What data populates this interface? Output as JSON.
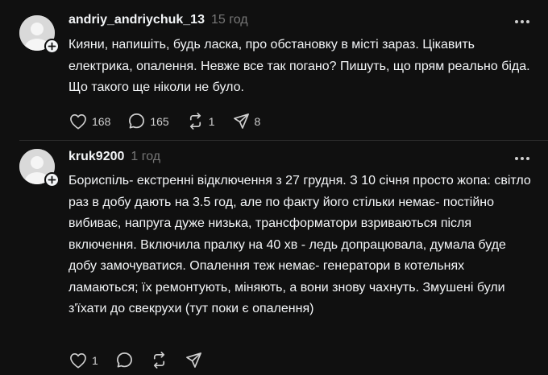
{
  "posts": [
    {
      "username": "andriy_andriychuk_13",
      "timestamp": "15 год",
      "text": "Кияни, напишіть, будь ласка, про обстановку в місті зараз. Цікавить електрика, опалення. Невже все так погано? Пишуть, що прям реально біда. Що такого ще ніколи не було.",
      "likes": "168",
      "replies": "165",
      "reposts": "1",
      "shares": "8"
    },
    {
      "username": "kruk9200",
      "timestamp": "1 год",
      "text": "Бориспіль- екстренні відключення з 27 грудня. З 10 січня просто жопа: світло раз в добу дають на 3.5 год, але по факту його стільки немає- постійно вибиває, напруга дуже низька, трансформатори взриваються після включення. Включила пралку на 40 хв - ледь допрацювала, думала буде добу замочуватися. Опалення теж немає- генератори в котельнях ламаються; їх ремонтують, міняють, а вони знову чахнуть. Змушені були з'їхати до свекрухи (тут поки є опалення)",
      "likes": "1",
      "replies": "",
      "reposts": "",
      "shares": ""
    }
  ],
  "icons": {
    "avatar": "default-avatar-icon",
    "follow": "plus-icon",
    "more": "more-dots-icon",
    "like": "heart-icon",
    "reply": "comment-bubble-icon",
    "repost": "repost-icon",
    "share": "send-icon"
  },
  "colors": {
    "background": "#101010",
    "text": "#f3f5f7",
    "muted": "#777777",
    "divider": "#2a2a2a"
  }
}
